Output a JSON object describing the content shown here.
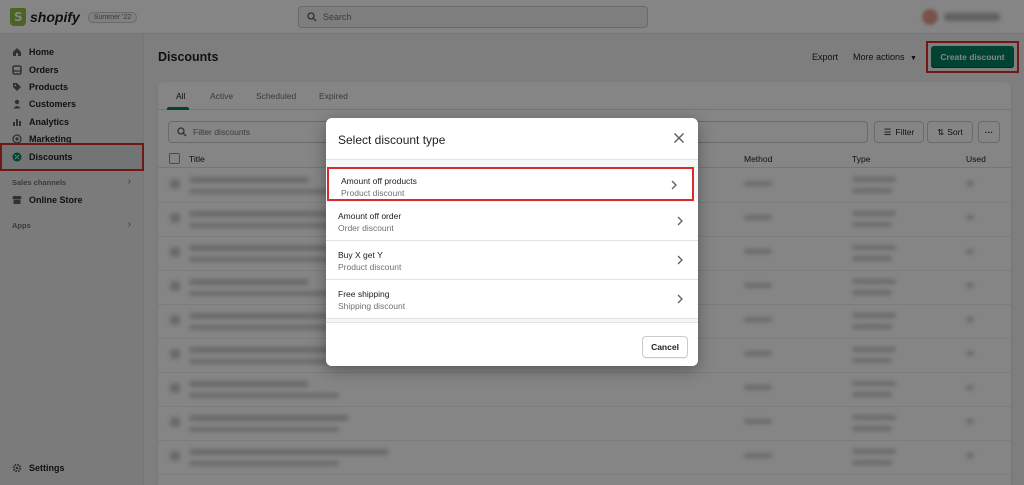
{
  "topbar": {
    "logo_text": "shopify",
    "badge": "Summer '22",
    "search_placeholder": "Search"
  },
  "sidebar": {
    "items": [
      {
        "label": "Home",
        "icon": "home-icon"
      },
      {
        "label": "Orders",
        "icon": "orders-icon"
      },
      {
        "label": "Products",
        "icon": "tag-icon"
      },
      {
        "label": "Customers",
        "icon": "person-icon"
      },
      {
        "label": "Analytics",
        "icon": "bar-chart-icon"
      },
      {
        "label": "Marketing",
        "icon": "target-icon"
      },
      {
        "label": "Discounts",
        "icon": "discount-icon"
      }
    ],
    "sales_channels_label": "Sales channels",
    "online_store_label": "Online Store",
    "apps_label": "Apps",
    "settings_label": "Settings"
  },
  "page": {
    "title": "Discounts",
    "export_label": "Export",
    "more_actions_label": "More actions",
    "create_label": "Create discount"
  },
  "tabs": [
    "All",
    "Active",
    "Scheduled",
    "Expired"
  ],
  "filter": {
    "placeholder": "Filter discounts",
    "filter_label": "Filter",
    "sort_label": "Sort"
  },
  "table": {
    "headers": {
      "title": "Title",
      "method": "Method",
      "type": "Type",
      "used": "Used"
    }
  },
  "modal": {
    "title": "Select discount type",
    "options": [
      {
        "title": "Amount off products",
        "subtitle": "Product discount"
      },
      {
        "title": "Amount off order",
        "subtitle": "Order discount"
      },
      {
        "title": "Buy X get Y",
        "subtitle": "Product discount"
      },
      {
        "title": "Free shipping",
        "subtitle": "Shipping discount"
      }
    ],
    "cancel_label": "Cancel"
  },
  "colors": {
    "accent": "#008060",
    "highlight": "#d72c2c",
    "logo_green": "#95bf47"
  }
}
